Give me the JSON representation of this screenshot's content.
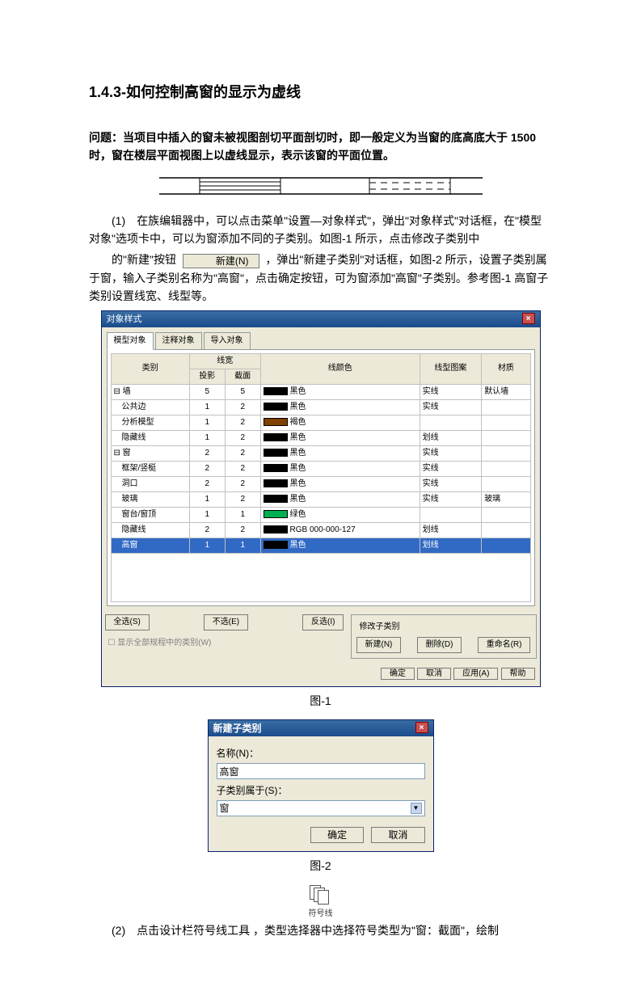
{
  "heading": "1.4.3-如何控制高窗的显示为虚线",
  "question": "问题：当项目中插入的窗未被视图剖切平面剖切时，即一般定义为当窗的底高底大于 1500 时，窗在楼层平面视图上以虚线显示，表示该窗的平面位置。",
  "p1a": "(1)　在族编辑器中，可以点击菜单\"设置—对象样式\"，弹出\"对象样式\"对话框，在\"模型对象\"选项卡中，可以为窗添加不同的子类别。如图-1 所示，点击修改子类别中",
  "p1b_pre": "的\"新建\"按钮",
  "new_btn": "新建(N)",
  "p1b_post": "，弹出\"新建子类别\"对话框，如图-2 所示，设置子类别属于窗，输入子类别名称为\"高窗\"，点击确定按钮，可为窗添加\"高窗\"子类别。参考图-1 高窗子类别设置线宽、线型等。",
  "dlg1": {
    "title": "对象样式",
    "tabs": [
      "模型对象",
      "注释对象",
      "导入对象"
    ],
    "headers": {
      "cat": "类别",
      "lw": "线宽",
      "proj": "投影",
      "cut": "截面",
      "color": "线颜色",
      "pattern": "线型图案",
      "mat": "材质"
    },
    "rows": [
      {
        "c": "⊟ 墙",
        "p": "5",
        "u": "5",
        "col": "#000",
        "cn": "黑色",
        "pat": "实线",
        "mat": "默认墙"
      },
      {
        "c": "　公共边",
        "p": "1",
        "u": "2",
        "col": "#000",
        "cn": "黑色",
        "pat": "实线",
        "mat": ""
      },
      {
        "c": "　分析模型",
        "p": "1",
        "u": "2",
        "col": "#804000",
        "cn": "褐色",
        "pat": "",
        "mat": ""
      },
      {
        "c": "　隐藏线",
        "p": "1",
        "u": "2",
        "col": "#000",
        "cn": "黑色",
        "pat": "划线",
        "mat": ""
      },
      {
        "c": "⊟ 窗",
        "p": "2",
        "u": "2",
        "col": "#000",
        "cn": "黑色",
        "pat": "实线",
        "mat": ""
      },
      {
        "c": "　框架/竖梃",
        "p": "2",
        "u": "2",
        "col": "#000",
        "cn": "黑色",
        "pat": "实线",
        "mat": ""
      },
      {
        "c": "　洞口",
        "p": "2",
        "u": "2",
        "col": "#000",
        "cn": "黑色",
        "pat": "实线",
        "mat": ""
      },
      {
        "c": "　玻璃",
        "p": "1",
        "u": "2",
        "col": "#000",
        "cn": "黑色",
        "pat": "实线",
        "mat": "玻璃"
      },
      {
        "c": "　窗台/窗顶",
        "p": "1",
        "u": "1",
        "col": "#00b050",
        "cn": "绿色",
        "pat": "",
        "mat": ""
      },
      {
        "c": "　隐藏线",
        "p": "2",
        "u": "2",
        "col": "#000",
        "cn": "RGB 000-000-127",
        "pat": "划线",
        "mat": ""
      },
      {
        "c": "　高窗",
        "p": "1",
        "u": "1",
        "col": "#000",
        "cn": "黑色",
        "pat": "划线",
        "mat": "",
        "sel": true
      }
    ],
    "bottom": {
      "selectAll": "全选(S)",
      "none": "不选(E)",
      "invert": "反选(I)",
      "chk": "显示全部规程中的类别(W)",
      "group": "修改子类别",
      "new": "新建(N)",
      "del": "删除(D)",
      "rename": "重命名(R)",
      "ok": "确定",
      "cancel": "取消",
      "apply": "应用(A)",
      "help": "帮助"
    }
  },
  "cap1": "图-1",
  "dlg2": {
    "title": "新建子类别",
    "nameLabel": "名称(N)：",
    "nameVal": "高窗",
    "belongLabel": "子类别属于(S)：",
    "belongVal": "窗",
    "ok": "确定",
    "cancel": "取消"
  },
  "cap2": "图-2",
  "tool": {
    "label": "符号线"
  },
  "p2_pre": "(2)　点击设计栏符号线工具",
  "p2_post": "，类型选择器中选择符号类型为\"窗：截面\"，绘制"
}
